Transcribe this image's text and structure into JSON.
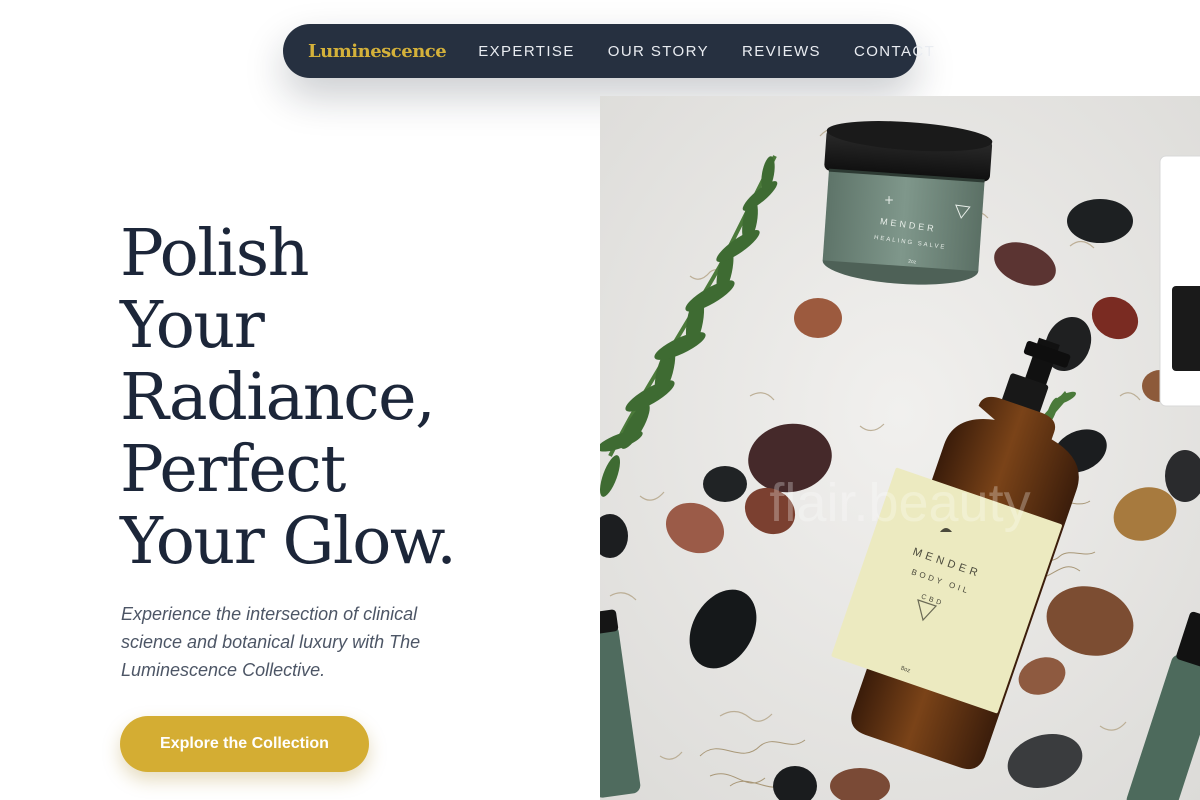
{
  "nav": {
    "brand": "Luminescence",
    "links": [
      "EXPERTISE",
      "OUR STORY",
      "REVIEWS",
      "CONTACT"
    ]
  },
  "hero": {
    "headline_lines": [
      "Polish",
      "Your",
      "Radiance,",
      "Perfect",
      "Your Glow."
    ],
    "subtitle": "Experience the intersection of clinical science and botanical luxury with The Luminescence Collective.",
    "cta_label": "Explore the Collection"
  },
  "image": {
    "watermark": "flair.beauty",
    "jar_label": {
      "brand": "MENDER",
      "product": "HEALING SALVE",
      "size": "2oz"
    },
    "bottle_label": {
      "brand": "MENDER",
      "product": "BODY OIL",
      "type": "CBD",
      "size": "8oz"
    }
  },
  "colors": {
    "nav_bg": "#263040",
    "brand_gold": "#d4b13a",
    "headline": "#1c2639",
    "cta_bg": "#d4ad33",
    "subtitle": "#4d5666"
  }
}
